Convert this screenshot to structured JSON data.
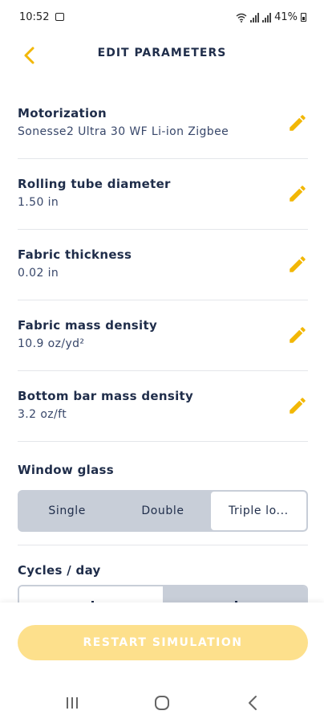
{
  "status_bar": {
    "time": "10:52",
    "wifi_tiny": "Wifi\nLTE1",
    "lte_tiny": "Voi\nLTE2",
    "battery": "41%"
  },
  "header": {
    "title": "EDIT PARAMETERS",
    "back_icon": "chevron-left-icon"
  },
  "parameters": [
    {
      "label": "Motorization",
      "value": "Sonesse2 Ultra 30 WF Li-ion Zigbee"
    },
    {
      "label": "Rolling tube diameter",
      "value": "1.50 in"
    },
    {
      "label": "Fabric thickness",
      "value": "0.02 in"
    },
    {
      "label": "Fabric mass density",
      "value": "10.9 oz/yd²"
    },
    {
      "label": "Bottom bar mass density",
      "value": "3.2 oz/ft"
    }
  ],
  "window_glass": {
    "label": "Window glass",
    "options": [
      "Single",
      "Double",
      "Triple lo..."
    ],
    "selected": "Triple lo..."
  },
  "cycles_per_day": {
    "label": "Cycles / day"
  },
  "restart_button": {
    "label": "RESTART SIMULATION"
  },
  "colors": {
    "accent": "#f2b705",
    "text_dark": "#1f2d4a",
    "button_disabled": "#fde08c",
    "segment_bg": "#c8ced8"
  },
  "navbar": {
    "icons": [
      "recent-apps-icon",
      "home-icon",
      "back-icon"
    ]
  }
}
